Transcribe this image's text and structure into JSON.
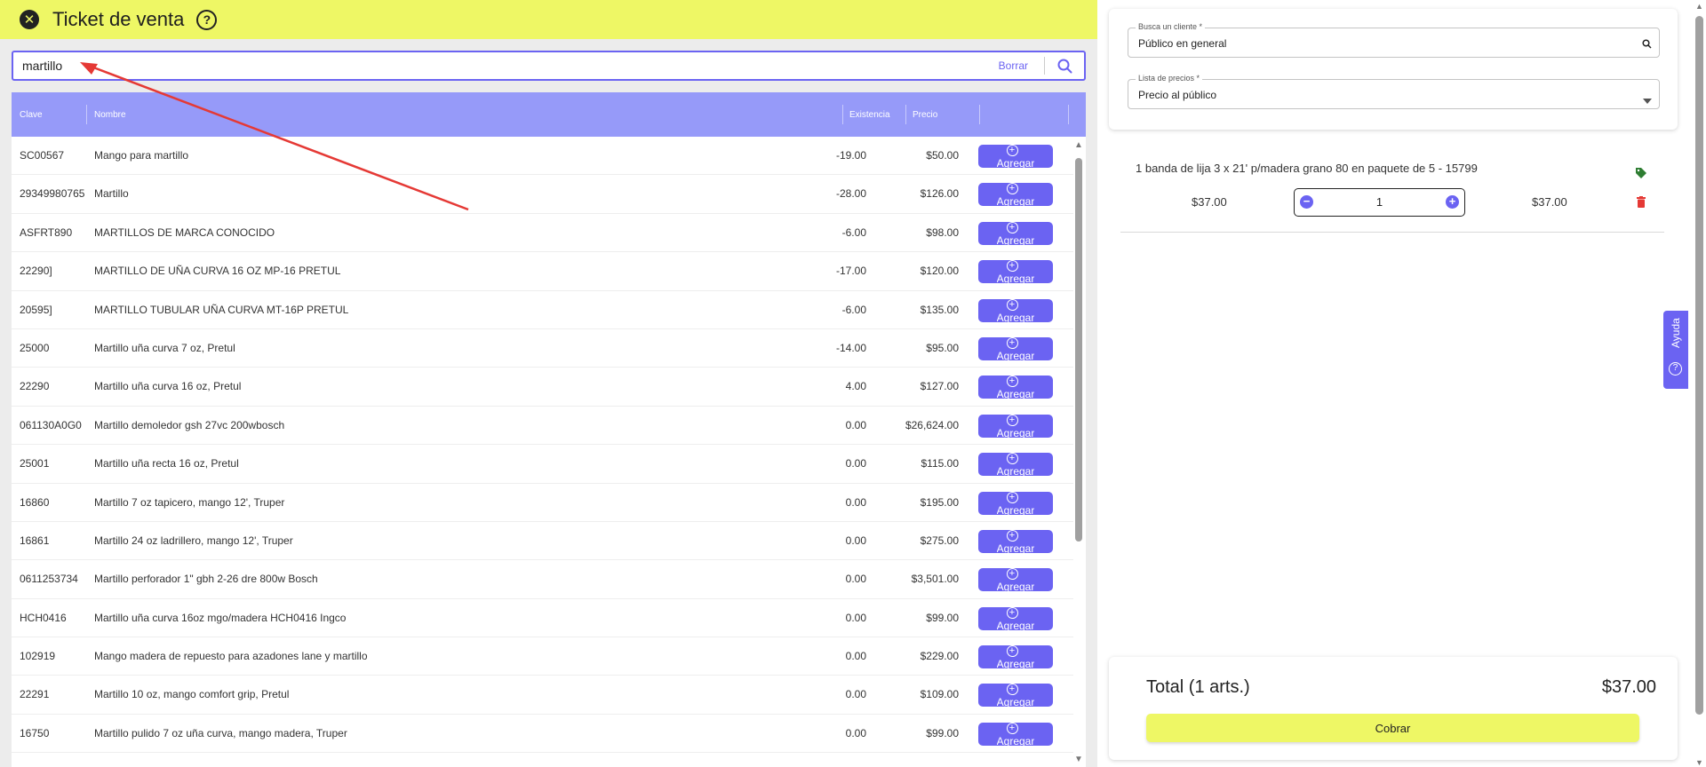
{
  "header": {
    "title": "Ticket de venta"
  },
  "search": {
    "value": "martillo",
    "clear_label": "Borrar"
  },
  "table": {
    "columns": [
      "Clave",
      "Nombre",
      "Existencia",
      "Precio"
    ],
    "add_label": "Agregar",
    "rows": [
      {
        "clave": "SC00567",
        "nombre": "Mango para martillo",
        "existencia": "-19.00",
        "precio": "$50.00"
      },
      {
        "clave": "29349980765",
        "nombre": "Martillo",
        "existencia": "-28.00",
        "precio": "$126.00"
      },
      {
        "clave": "ASFRT890",
        "nombre": "MARTILLOS DE MARCA CONOCIDO",
        "existencia": "-6.00",
        "precio": "$98.00"
      },
      {
        "clave": "22290]",
        "nombre": "MARTILLO DE UÑA CURVA 16 OZ MP-16 PRETUL",
        "existencia": "-17.00",
        "precio": "$120.00"
      },
      {
        "clave": "20595]",
        "nombre": "MARTILLO TUBULAR UÑA CURVA MT-16P PRETUL",
        "existencia": "-6.00",
        "precio": "$135.00"
      },
      {
        "clave": "25000",
        "nombre": "Martillo uña curva 7 oz, Pretul",
        "existencia": "-14.00",
        "precio": "$95.00"
      },
      {
        "clave": "22290",
        "nombre": "Martillo uña curva 16 oz, Pretul",
        "existencia": "4.00",
        "precio": "$127.00"
      },
      {
        "clave": "061130A0G0",
        "nombre": "Martillo demoledor gsh 27vc 200wbosch",
        "existencia": "0.00",
        "precio": "$26,624.00"
      },
      {
        "clave": "25001",
        "nombre": "Martillo uña recta 16 oz, Pretul",
        "existencia": "0.00",
        "precio": "$115.00"
      },
      {
        "clave": "16860",
        "nombre": "Martillo 7 oz tapicero, mango 12', Truper",
        "existencia": "0.00",
        "precio": "$195.00"
      },
      {
        "clave": "16861",
        "nombre": "Martillo 24 oz ladrillero, mango 12', Truper",
        "existencia": "0.00",
        "precio": "$275.00"
      },
      {
        "clave": "0611253734",
        "nombre": "Martillo perforador 1\" gbh 2-26 dre 800w Bosch",
        "existencia": "0.00",
        "precio": "$3,501.00"
      },
      {
        "clave": "HCH0416",
        "nombre": "Martillo uña curva 16oz mgo/madera HCH0416 Ingco",
        "existencia": "0.00",
        "precio": "$99.00"
      },
      {
        "clave": "102919",
        "nombre": "Mango madera de repuesto para azadones lane y martillo",
        "existencia": "0.00",
        "precio": "$229.00"
      },
      {
        "clave": "22291",
        "nombre": "Martillo 10 oz, mango comfort grip, Pretul",
        "existencia": "0.00",
        "precio": "$109.00"
      },
      {
        "clave": "16750",
        "nombre": "Martillo pulido 7 oz uña curva, mango madera, Truper",
        "existencia": "0.00",
        "precio": "$99.00"
      }
    ]
  },
  "customer": {
    "label": "Busca un cliente *",
    "value": "Público en general"
  },
  "price_list": {
    "label": "Lista de precios *",
    "value": "Precio al público"
  },
  "cart": {
    "items": [
      {
        "name": "1 banda de lija 3 x 21' p/madera grano 80 en paquete de 5 - 15799",
        "unit_price": "$37.00",
        "quantity": "1",
        "total": "$37.00"
      }
    ]
  },
  "help_tab": {
    "label": "Ayuda"
  },
  "summary": {
    "total_label": "Total (1 arts.)",
    "total_value": "$37.00",
    "charge_label": "Cobrar"
  },
  "colors": {
    "accent": "#6b63f2",
    "header_bg": "#eef765",
    "table_header": "#969af9",
    "annotation": "#e53935"
  },
  "icons": [
    "close-icon",
    "help-icon",
    "search-icon",
    "plus-circle-icon",
    "tag-icon",
    "trash-icon",
    "chevron-down-icon"
  ]
}
